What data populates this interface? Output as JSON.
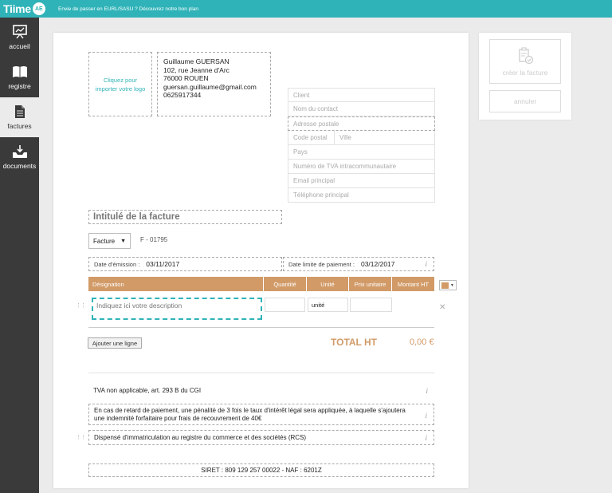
{
  "app": {
    "logo_text": "Tiime",
    "logo_badge": "AE",
    "promo": "Envie de passer en EURL/SASU ? Découvrez notre bon plan"
  },
  "sidebar": {
    "items": [
      {
        "label": "accueil",
        "icon": "presentation-board-icon"
      },
      {
        "label": "registre",
        "icon": "open-book-icon"
      },
      {
        "label": "factures",
        "icon": "document-icon"
      },
      {
        "label": "documents",
        "icon": "inbox-tray-icon"
      }
    ],
    "active": "factures"
  },
  "invoice": {
    "logo_placeholder": "Cliquez pour importer votre logo",
    "sender": {
      "name": "Guillaume GUERSAN",
      "address": "102, rue Jeanne d'Arc",
      "city": "76000 ROUEN",
      "email": "guersan.guillaume@gmail.com",
      "phone": "0625917344"
    },
    "client_fields": {
      "client": "Client",
      "contact": "Nom du contact",
      "address": "Adresse postale",
      "postal": "Code postal",
      "city": "Ville",
      "country": "Pays",
      "vat": "Numéro de TVA intracommunautaire",
      "email": "Email principal",
      "phone": "Téléphone principal"
    },
    "title": "Intitulé de la facture",
    "type": "Facture",
    "number": "F - 01795",
    "emission_label": "Date d'émission :",
    "emission_date": "03/11/2017",
    "due_label": "Date limite de paiement :",
    "due_date": "03/12/2017",
    "table": {
      "headers": [
        "Désignation",
        "Quantité",
        "Unité",
        "Prix unitaire",
        "Montant HT"
      ],
      "description_placeholder": "Indiquez ici votre description",
      "unit_value": "unité"
    },
    "add_line": "Ajouter une ligne",
    "total_label": "TOTAL HT",
    "total_value": "0,00 €",
    "mentions": [
      "TVA non applicable, art. 293 B du CGI",
      "En cas de retard de paiement, une pénalité de 3 fois le taux d'intérêt légal sera appliquée, à laquelle s'ajoutera une indemnité forfaitaire pour frais de recouvrement de 40€",
      "Dispensé d'immatriculation au registre du commerce et des sociétés (RCS)"
    ],
    "siret": "SIRET : 809 129 257 00022 - NAF : 6201Z"
  },
  "actions": {
    "create": "créer la facture",
    "cancel": "annuler"
  },
  "colors": {
    "brand": "#2fb3b8",
    "accent": "#d19a67",
    "sidebar": "#3a3a3a"
  }
}
